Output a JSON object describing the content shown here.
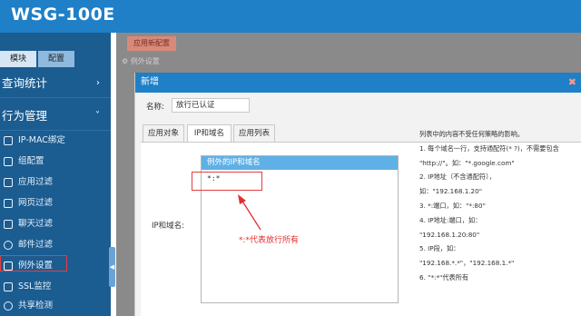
{
  "app": {
    "title": "WSG-100E"
  },
  "sidebar": {
    "tabs": [
      "模块",
      "配置"
    ],
    "sections": [
      {
        "label": "查询统计",
        "chevron": "›"
      },
      {
        "label": "行为管理",
        "chevron": "˅"
      }
    ],
    "items": [
      {
        "label": "IP-MAC绑定",
        "icon": "shield-icon"
      },
      {
        "label": "组配置",
        "icon": "group-icon"
      },
      {
        "label": "应用过滤",
        "icon": "filter-icon"
      },
      {
        "label": "网页过滤",
        "icon": "document-icon"
      },
      {
        "label": "聊天过滤",
        "icon": "chat-icon"
      },
      {
        "label": "邮件过滤",
        "icon": "at-icon"
      },
      {
        "label": "例外设置",
        "icon": "exception-icon",
        "selected": true
      },
      {
        "label": "SSL监控",
        "icon": "lock-icon"
      },
      {
        "label": "共享检测",
        "icon": "share-icon"
      }
    ]
  },
  "background": {
    "apply_button": "应用新配置",
    "breadcrumb": "例外设置"
  },
  "dialog": {
    "title": "新增",
    "name_label": "名称:",
    "name_value": "放行已认证",
    "tabs": [
      "应用对象",
      "IP和域名",
      "应用列表"
    ],
    "ip_label": "IP和域名:",
    "ip_box_title": "例外的IP和域名",
    "ip_value": "*:*",
    "annotation": "*:*代表放行所有",
    "help_lines": [
      "列表中的内容不受任何策略的影响。",
      "1. 每个域名一行，支持通配符(* ?)，不需要包含",
      "\"http://\"。如：\"*.google.com\"",
      "2. IP地址（不含通配符），",
      "如：\"192.168.1.20\"",
      "3. *:端口，如：\"*:80\"",
      "4. IP地址:端口，如：",
      "\"192.168.1.20:80\"",
      "5. IP段，如：",
      "\"192.168.*.*\"，\"192.168.1.*\"",
      "6. \"*:*\"代表所有"
    ]
  },
  "colors": {
    "topbar": "#1f7fc7",
    "sidebar": "#1b5c91",
    "annotation": "#e03030"
  }
}
